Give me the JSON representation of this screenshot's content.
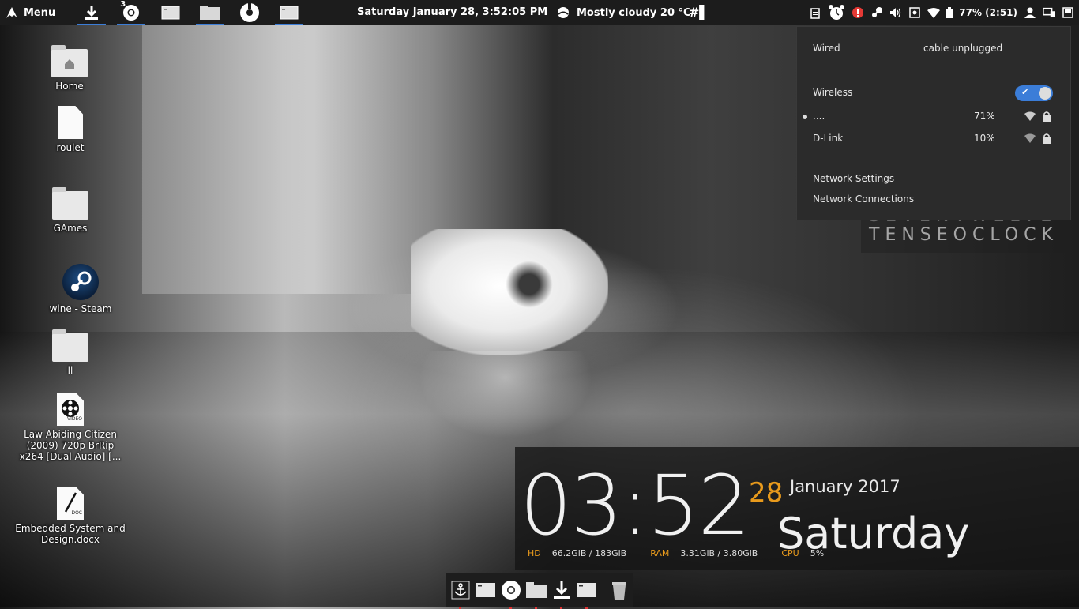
{
  "top_panel": {
    "menu_label": "Menu",
    "chrome_badge": "3",
    "datetime": "Saturday January 28,  3:52:05 PM",
    "weather": "Mostly cloudy 20 °C",
    "workspace": "#▌",
    "battery": "77% (2:51)"
  },
  "desktop_icons": [
    {
      "label": "Home"
    },
    {
      "label": "roulet"
    },
    {
      "label": "GAmes"
    },
    {
      "label": "wine - Steam"
    },
    {
      "label": "ll"
    },
    {
      "label": "Law Abiding Citizen (2009) 720p BrRip x264 [Dual Audio] [..."
    },
    {
      "label": "Embedded System and Design.docx"
    }
  ],
  "doc_badges": {
    "video": "VIDEO",
    "doc": "DOC"
  },
  "network_popup": {
    "wired_label": "Wired",
    "wired_status": "cable unplugged",
    "wireless_label": "Wireless",
    "networks": [
      {
        "name": "....",
        "strength": "71%"
      },
      {
        "name": "D-Link",
        "strength": "10%"
      }
    ],
    "settings_link": "Network Settings",
    "connections_link": "Network Connections"
  },
  "wallpaper_text": [
    "SEVENTWELVE",
    "TENSEOCLOCK"
  ],
  "conky": {
    "time": "03:52",
    "day": "28",
    "month_year": "January 2017",
    "weekday": "Saturday",
    "hd_label": "HD",
    "hd_value": "66.2GiB / 183GiB",
    "ram_label": "RAM",
    "ram_value": "3.31GiB / 3.80GiB",
    "cpu_label": "CPU",
    "cpu_value": "5%"
  },
  "colors": {
    "accent": "#3b7dd8",
    "conky_orange": "#e89a1c",
    "panel_bg": "#1c1c1c"
  }
}
